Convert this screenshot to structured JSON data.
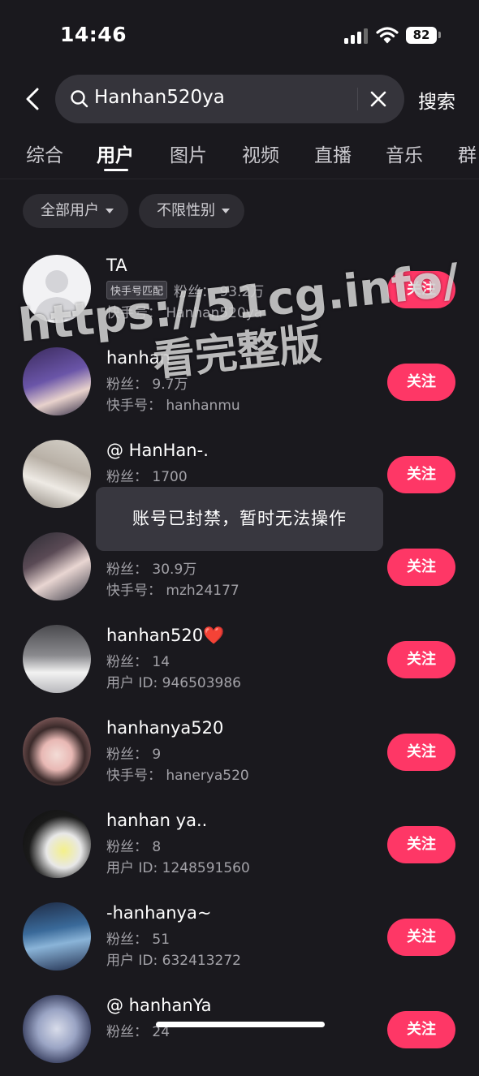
{
  "status_bar": {
    "time": "14:46",
    "battery": "82"
  },
  "search": {
    "query": "Hanhan520ya",
    "search_button": "搜索"
  },
  "tabs": [
    {
      "label": "综合"
    },
    {
      "label": "用户"
    },
    {
      "label": "图片"
    },
    {
      "label": "视频"
    },
    {
      "label": "直播"
    },
    {
      "label": "音乐"
    },
    {
      "label": "群"
    }
  ],
  "filters": [
    {
      "label": "全部用户"
    },
    {
      "label": "不限性别"
    }
  ],
  "follow_label": "关注",
  "users": [
    {
      "name": "TA",
      "badge": "快手号匹配",
      "fans": "粉丝： 93.2万",
      "id_line": "快手号： Hanhan520ya"
    },
    {
      "name": "hanhan",
      "fans": "粉丝： 9.7万",
      "id_line": "快手号： hanhanmu"
    },
    {
      "name": "@ HanHan-.",
      "fans": "粉丝： 1700",
      "id_line": ""
    },
    {
      "name": "",
      "fans": "粉丝： 30.9万",
      "id_line": "快手号： mzh24177"
    },
    {
      "name": "hanhan520❤️",
      "fans": "粉丝： 14",
      "id_line": "用户 ID: 946503986"
    },
    {
      "name": "hanhanya520",
      "fans": "粉丝： 9",
      "id_line": "快手号： hanerya520"
    },
    {
      "name": "hanhan ya..",
      "fans": "粉丝： 8",
      "id_line": "用户 ID: 1248591560"
    },
    {
      "name": "-hanhanya~",
      "fans": "粉丝： 51",
      "id_line": "用户 ID: 632413272"
    },
    {
      "name": "@ hanhanYa",
      "fans": "粉丝： 24",
      "id_line": ""
    }
  ],
  "toast": "账号已封禁，暂时无法操作",
  "watermark": {
    "line1": "https://51cg.info/",
    "line2": "看完整版"
  }
}
